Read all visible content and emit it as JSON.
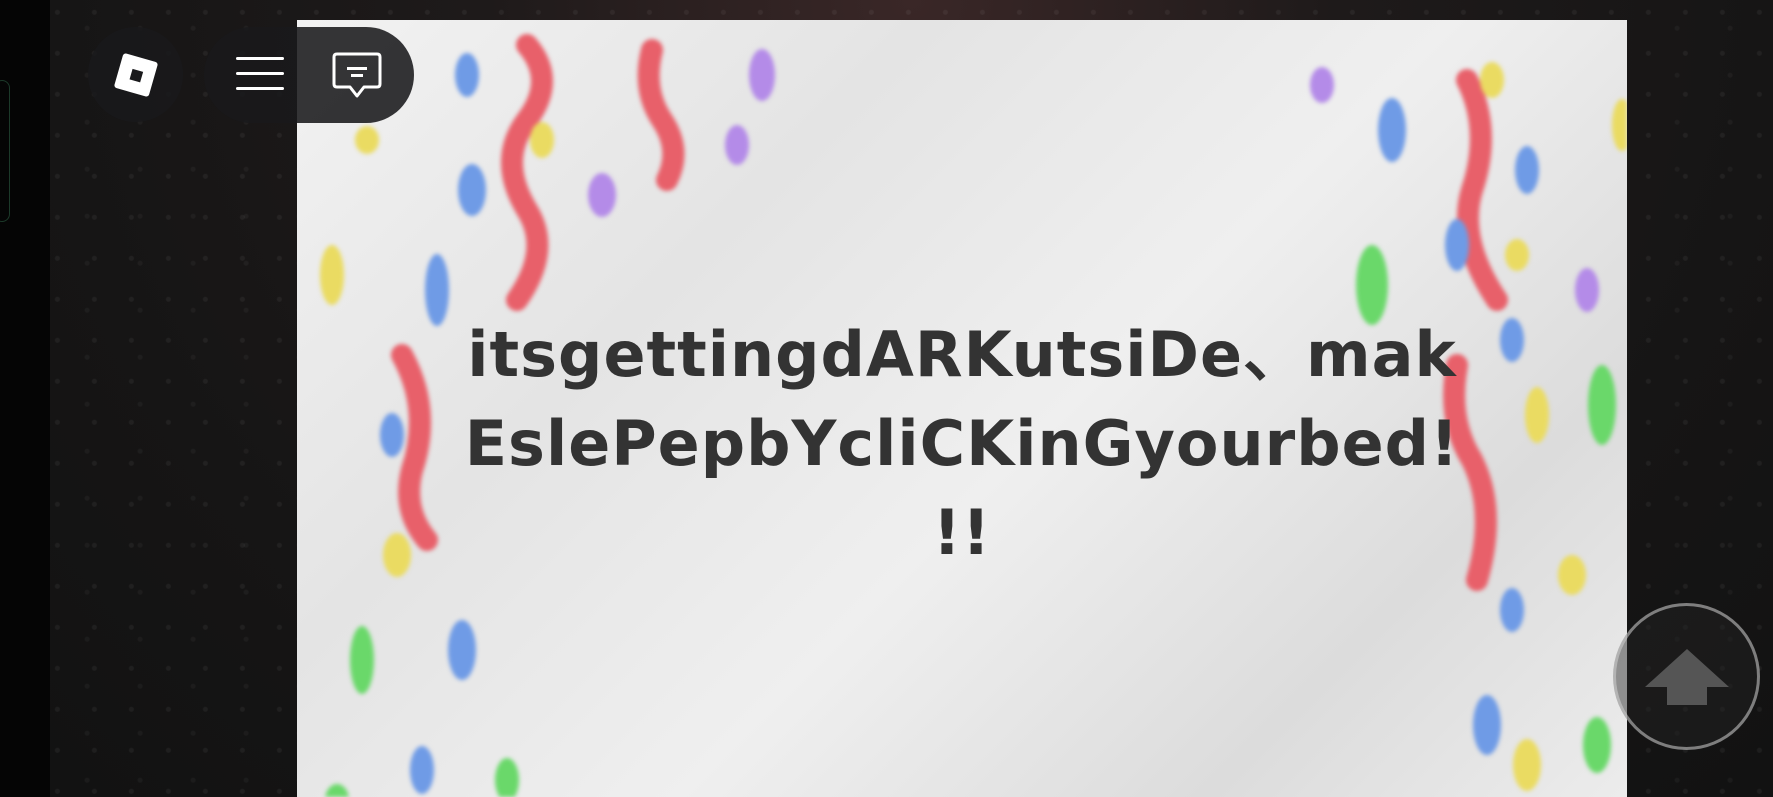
{
  "game": {
    "message_line1": "itsgettingdARKutsiDe、mak",
    "message_line2": "EslePepbYcliCKinGyourbed!",
    "message_line3": "!!"
  },
  "topbar": {
    "logo_icon": "roblox-logo-icon",
    "menu_icon": "hamburger-icon",
    "chat_icon": "chat-icon"
  },
  "controls": {
    "jump_icon": "up-arrow-icon"
  },
  "colors": {
    "paper": "#ececec",
    "text": "#333333",
    "ui_dark": "#19191b",
    "sprinkle_red": "#e8606a",
    "sprinkle_blue": "#6f9be6",
    "sprinkle_purple": "#b48be8",
    "sprinkle_yellow": "#eadb62",
    "sprinkle_green": "#6ad86a"
  }
}
